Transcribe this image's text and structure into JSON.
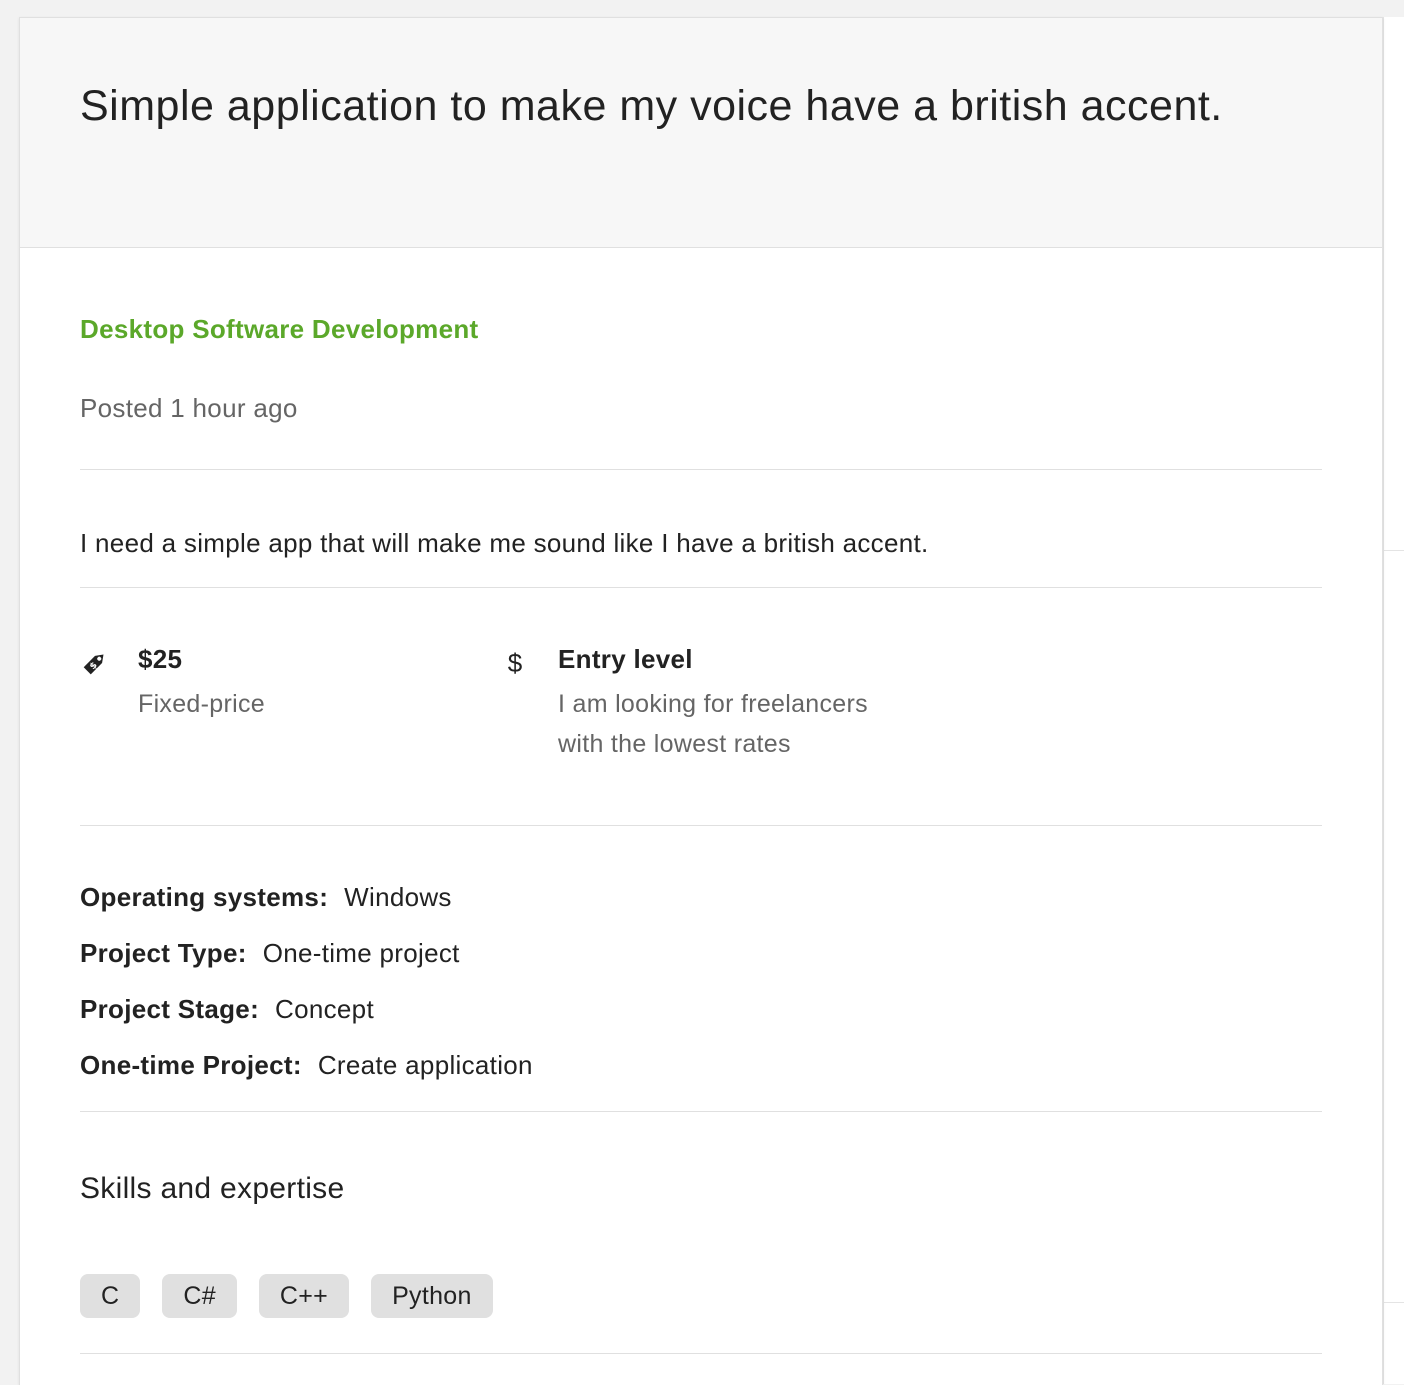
{
  "job": {
    "title": "Simple application to make my voice have a british accent.",
    "category": "Desktop Software Development",
    "posted": "Posted 1 hour ago",
    "description": "I need a simple app that will make me sound like I have a british accent."
  },
  "budget": {
    "icon": "price-tag-icon",
    "amount": "$25",
    "type": "Fixed-price"
  },
  "experience": {
    "icon": "dollar-sign-icon",
    "symbol": "$",
    "level": "Entry level",
    "description": "I am looking for freelancers with the lowest rates"
  },
  "attributes": [
    {
      "label": "Operating systems:",
      "value": "Windows"
    },
    {
      "label": "Project Type:",
      "value": "One-time project"
    },
    {
      "label": "Project Stage:",
      "value": "Concept"
    },
    {
      "label": "One-time Project:",
      "value": "Create application"
    }
  ],
  "skills": {
    "heading": "Skills and expertise",
    "items": [
      "C",
      "C#",
      "C++",
      "Python"
    ]
  },
  "colors": {
    "category_green": "#5ba82a",
    "header_bg": "#f7f7f7",
    "skill_bg": "#e0e0e0",
    "muted_text": "#656565"
  }
}
